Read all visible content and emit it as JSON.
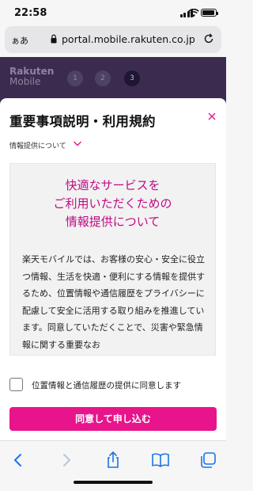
{
  "status_bar": {
    "time": "22:58"
  },
  "browser": {
    "aa_label": "ぁあ",
    "url": "portal.mobile.rakuten.co.jp"
  },
  "background_page": {
    "logo_line1": "Rakuten",
    "logo_line2": "Mobile",
    "steps": [
      "1",
      "2",
      "3"
    ],
    "active_step": "3"
  },
  "modal": {
    "title": "重要事項説明・利用規約",
    "section_selector": "情報提供について",
    "panel": {
      "heading_lines": [
        "快適なサービスを",
        "ご利用いただくための",
        "情報提供について"
      ],
      "body": "楽天モバイルでは、お客様の安心・安全に役立つ情報、生活を快適・便利にする情報を提供するため、位置情報や通信履歴をプライバシーに配慮して安全に活用する取り組みを推進しています。同意していただくことで、災害や緊急情報に関する重要なお"
    },
    "agree_label": "位置情報と通信履歴の提供に同意します",
    "agree_checked": false,
    "submit_label": "同意して申し込む"
  },
  "colors": {
    "accent": "#e8148c",
    "heading_magenta": "#bf0a84",
    "header_bg": "#3b2c4f"
  },
  "toolbar_icons": [
    "back-icon",
    "forward-icon",
    "share-icon",
    "bookmarks-icon",
    "tabs-icon"
  ]
}
